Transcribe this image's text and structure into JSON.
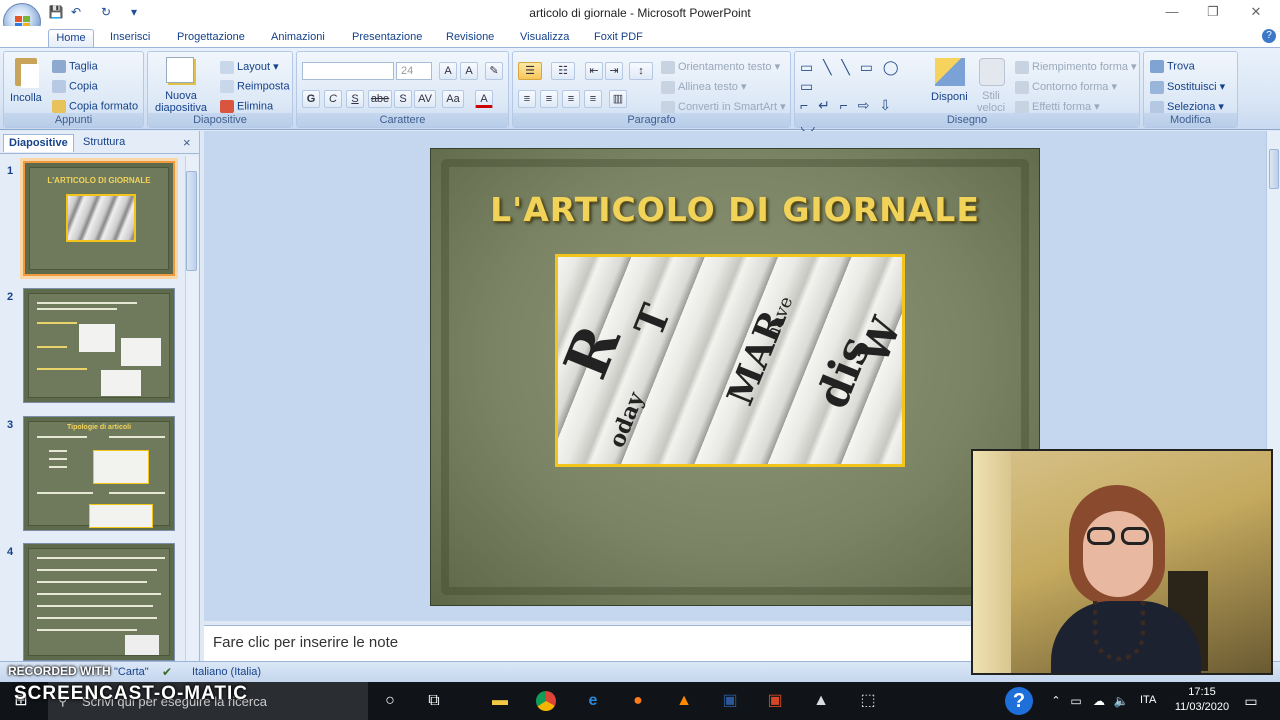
{
  "window": {
    "title": "articolo di giornale - Microsoft PowerPoint",
    "controls": [
      "—",
      "❐",
      "✕"
    ]
  },
  "qat": {
    "save": "💾",
    "undo": "↶",
    "redo": "↻",
    "more": "▾"
  },
  "tabs": [
    "Home",
    "Inserisci",
    "Progettazione",
    "Animazioni",
    "Presentazione",
    "Revisione",
    "Visualizza",
    "Foxit PDF"
  ],
  "ribbon": {
    "appunti": {
      "label": "Appunti",
      "paste": "Incolla",
      "cut": "Taglia",
      "copy": "Copia",
      "format_painter": "Copia formato"
    },
    "diapositive": {
      "label": "Diapositive",
      "new_slide_1": "Nuova",
      "new_slide_2": "diapositiva",
      "layout": "Layout",
      "reset": "Reimposta",
      "delete": "Elimina"
    },
    "carattere": {
      "label": "Carattere",
      "font_size": "24",
      "bold": "G",
      "italic": "C",
      "underline": "S",
      "strike": "abe",
      "shadow": "S",
      "spacing": "AV",
      "case": "Aa",
      "color": "A"
    },
    "paragrafo": {
      "label": "Paragrafo",
      "text_direction": "Orientamento testo",
      "align_text": "Allinea testo",
      "smartart": "Converti in SmartArt"
    },
    "disegno": {
      "label": "Disegno",
      "arrange": "Disponi",
      "styles_1": "Stili",
      "styles_2": "veloci",
      "fill": "Riempimento forma",
      "outline": "Contorno forma",
      "effects": "Effetti forma"
    },
    "modifica": {
      "label": "Modifica",
      "find": "Trova",
      "replace": "Sostituisci",
      "select": "Seleziona"
    }
  },
  "panel": {
    "tabs": [
      "Diapositive",
      "Struttura"
    ],
    "close": "×",
    "slides": [
      {
        "num": "1",
        "title": "L'ARTICOLO DI GIORNALE"
      },
      {
        "num": "2",
        "title": "In un giornale l'articolo riporta fatti, notizie, opinioni e commenti"
      },
      {
        "num": "3",
        "title": "Tipologie di articoli"
      },
      {
        "num": "4",
        "title": ""
      }
    ]
  },
  "slide": {
    "title": "L'ARTICOLO DI GIORNALE"
  },
  "notes": {
    "placeholder": "Fare clic per inserire le note"
  },
  "status": {
    "recorded": "RECORDED WITH",
    "theme": "\"Carta\"",
    "language": "Italiano (Italia)",
    "brand": "SCREENCAST-O-MATIC"
  },
  "taskbar": {
    "search_placeholder": "Scrivi qui per eseguire la ricerca",
    "time": "17:15",
    "date": "11/03/2020",
    "language": "ITA"
  },
  "colors": {
    "accent": "#15428b",
    "slide_title": "#f2d35a",
    "selection": "#f09a3f",
    "picture_border": "#f3c51b"
  }
}
